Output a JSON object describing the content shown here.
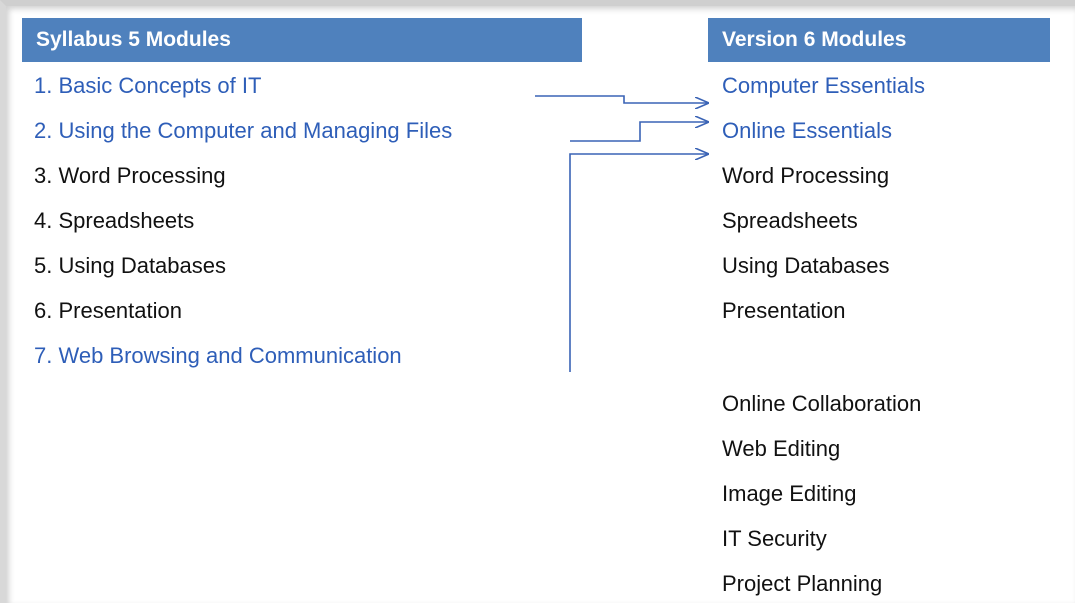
{
  "colors": {
    "header_bg": "#4f81bd",
    "highlight_text": "#2e5eb8",
    "normal_text": "#111111",
    "arrow": "#3a63b5"
  },
  "syllabus5": {
    "title": "Syllabus 5 Modules",
    "items": [
      {
        "label": "1. Basic Concepts of IT",
        "highlight": true
      },
      {
        "label": "2. Using the Computer and Managing Files",
        "highlight": true
      },
      {
        "label": "3. Word Processing",
        "highlight": false
      },
      {
        "label": "4. Spreadsheets",
        "highlight": false
      },
      {
        "label": "5. Using Databases",
        "highlight": false
      },
      {
        "label": "6. Presentation",
        "highlight": false
      },
      {
        "label": "7. Web Browsing and Communication",
        "highlight": true
      }
    ]
  },
  "version6": {
    "title": "Version 6 Modules",
    "items": [
      {
        "label": "Computer Essentials",
        "highlight": true
      },
      {
        "label": "Online Essentials",
        "highlight": true
      },
      {
        "label": "Word Processing",
        "highlight": false
      },
      {
        "label": "Spreadsheets",
        "highlight": false
      },
      {
        "label": "Using Databases",
        "highlight": false
      },
      {
        "label": "Presentation",
        "highlight": false
      },
      {
        "label": "Online Collaboration",
        "highlight": false
      },
      {
        "label": "Web Editing",
        "highlight": false
      },
      {
        "label": "Image Editing",
        "highlight": false
      },
      {
        "label": "IT Security",
        "highlight": false
      },
      {
        "label": "Project Planning",
        "highlight": false
      }
    ]
  },
  "mappings": [
    {
      "from": 0,
      "to": 0
    },
    {
      "from": 1,
      "to": 1
    },
    {
      "from": 6,
      "to": 2
    }
  ]
}
